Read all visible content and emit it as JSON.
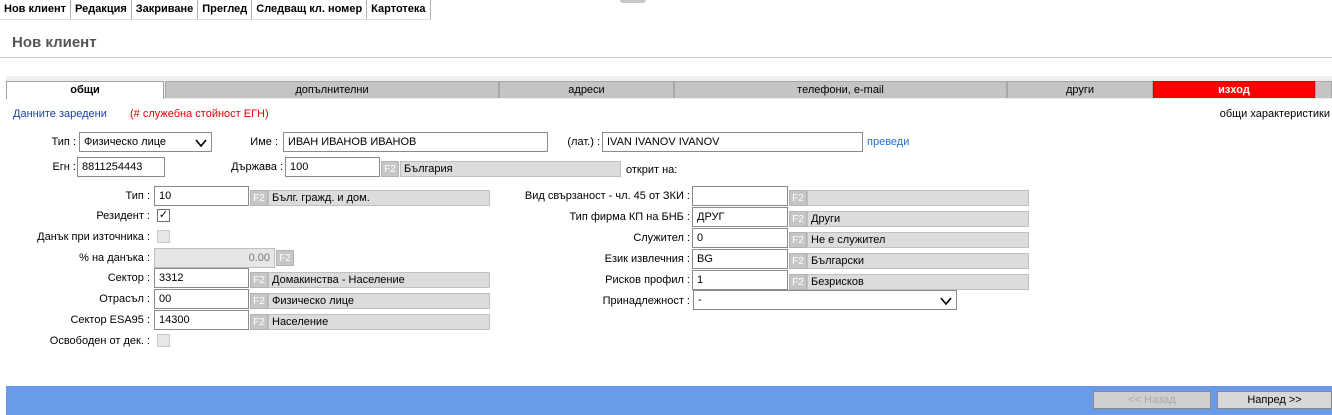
{
  "menu": [
    "Нов клиент",
    "Редакция",
    "Закриване",
    "Преглед",
    "Следващ кл. номер",
    "Картотека"
  ],
  "page_title": "Нов клиент",
  "tabs": [
    "общи",
    "допълнителни",
    "адреси",
    "телефони, e-mail",
    "други",
    "изход"
  ],
  "status": {
    "loaded": "Данните заредени",
    "note": "(# служебна стойност ЕГН)",
    "section": "общи характеристики"
  },
  "head": {
    "type_label": "Тип :",
    "type_value": "Физическо лице",
    "name_label": "Име :",
    "name_value": "ИВАН ИВАНОВ ИВАНОВ",
    "lat_label": "(лат.) :",
    "lat_value": "IVAN IVANOV IVANOV",
    "translate": "преведи",
    "egn_label": "Егн :",
    "egn_value": "8811254443",
    "country_label": "Държава :",
    "country_code": "100",
    "country_name": "България",
    "opened_label": "открит на:"
  },
  "f2": "F2",
  "left": {
    "type_label": "Тип :",
    "type_code": "10",
    "type_desc": "Бълг. гражд. и дом.",
    "resident_label": "Резидент :",
    "resident_mark": "✓",
    "tax_label": "Данък при източника :",
    "tax_pct_label": "% на данъка :",
    "tax_pct_value": "0.00",
    "sector_label": "Сектор :",
    "sector_code": "3312",
    "sector_desc": "Домакинства - Население",
    "branch_label": "Отрасъл :",
    "branch_code": "00",
    "branch_desc": "Физическо лице",
    "esa_label": "Сектор ESA95 :",
    "esa_code": "14300",
    "esa_desc": "Население",
    "exempt_label": "Освободен от дек. :"
  },
  "right": {
    "relation_label": "Вид свързаност - чл. 45 от ЗКИ :",
    "relation_code": "",
    "relation_desc": "",
    "firm_label": "Тип фирма КП на БНБ :",
    "firm_code": "ДРУГ",
    "firm_desc": "Други",
    "employee_label": "Служител :",
    "employee_code": "0",
    "employee_desc": "Не е служител",
    "lang_label": "Език извлечния :",
    "lang_code": "BG",
    "lang_desc": "Български",
    "risk_label": "Рисков профил :",
    "risk_code": "1",
    "risk_desc": "Безрисков",
    "belong_label": "Принадлежност :",
    "belong_value": "-"
  },
  "footer": {
    "back": "<< Назад",
    "next": "Напред >>"
  }
}
